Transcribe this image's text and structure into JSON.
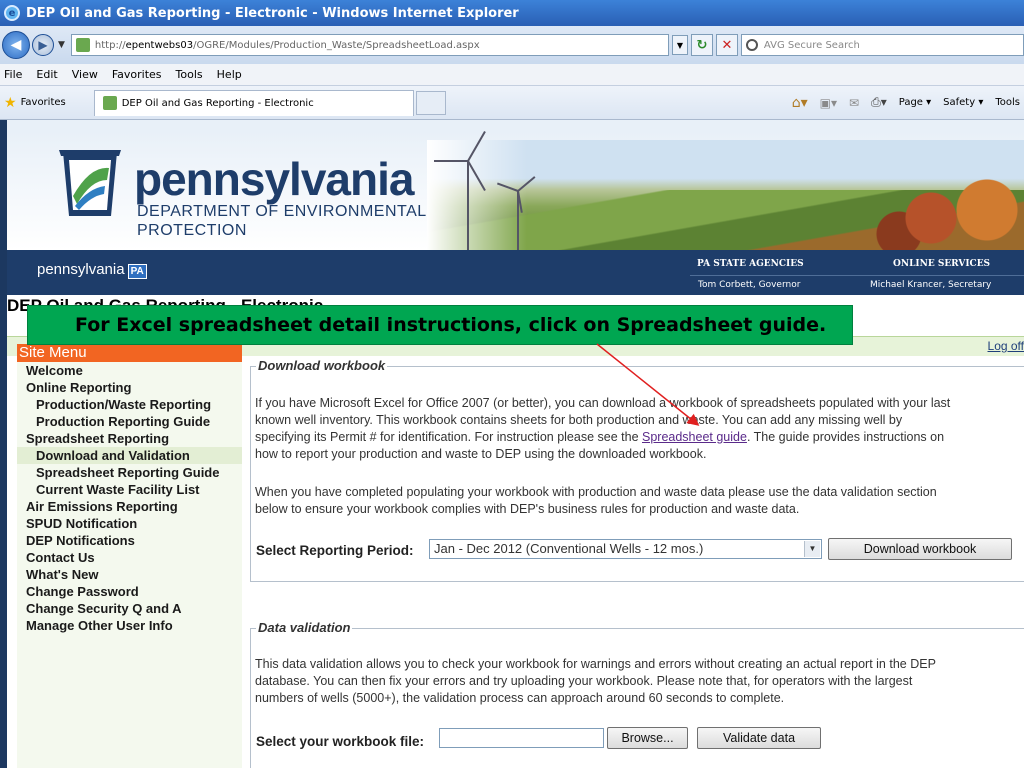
{
  "window": {
    "title": "DEP Oil and Gas Reporting - Electronic - Windows Internet Explorer"
  },
  "addressbar": {
    "url_prefix": "http://",
    "url_host": "epentwebs03",
    "url_path": "/OGRE/Modules/Production_Waste/SpreadsheetLoad.aspx",
    "search_placeholder": "AVG Secure Search"
  },
  "menubar": {
    "items": [
      "File",
      "Edit",
      "View",
      "Favorites",
      "Tools",
      "Help"
    ]
  },
  "favbar": {
    "favorites_label": "Favorites",
    "tab_title": "DEP Oil and Gas Reporting - Electronic",
    "commands": [
      "Page",
      "Safety",
      "Tools"
    ]
  },
  "banner": {
    "brand": "pennsylvania",
    "dept_line1": "DEPARTMENT OF ENVIRONMENTAL",
    "dept_line2": "PROTECTION"
  },
  "navstrip": {
    "pa_text": "pennsylvania",
    "pa_badge": "PA",
    "agencies": "PA STATE AGENCIES",
    "services": "ONLINE SERVICES",
    "governor": "Tom Corbett, Governor",
    "secretary": "Michael Krancer, Secretary"
  },
  "site_title": "DEP Oil and Gas Reporting - Electronic",
  "logoff": "Log off",
  "callout": "For Excel spreadsheet  detail instructions, click on Spreadsheet guide.",
  "sidemenu": {
    "heading": "Site Menu",
    "items": [
      {
        "label": "Welcome",
        "level": 1
      },
      {
        "label": "Online Reporting",
        "level": 1
      },
      {
        "label": "Production/Waste Reporting",
        "level": 2
      },
      {
        "label": "Production Reporting Guide",
        "level": 2
      },
      {
        "label": "Spreadsheet Reporting",
        "level": 1
      },
      {
        "label": "Download and Validation",
        "level": 2,
        "active": true
      },
      {
        "label": "Spreadsheet Reporting Guide",
        "level": 2
      },
      {
        "label": "Current Waste Facility List",
        "level": 2
      },
      {
        "label": "Air Emissions Reporting",
        "level": 1
      },
      {
        "label": "SPUD Notification",
        "level": 1
      },
      {
        "label": "DEP Notifications",
        "level": 1
      },
      {
        "label": "Contact Us",
        "level": 1
      },
      {
        "label": "What's New",
        "level": 1
      },
      {
        "label": "Change Password",
        "level": 1
      },
      {
        "label": "Change Security Q and A",
        "level": 1
      },
      {
        "label": "Manage Other User Info",
        "level": 1
      }
    ]
  },
  "download": {
    "legend": "Download workbook",
    "para1_a": "If you have Microsoft Excel for Office 2007 (or better), you can download a workbook of spreadsheets populated with your last",
    "para1_b": "known well inventory. This workbook contains sheets for both production and waste. You can add any missing well by",
    "para1_c_pre": "specifying its Permit # for identification. For instruction please see the ",
    "para1_c_link": "Spreadsheet guide",
    "para1_c_post": ". The guide provides instructions on",
    "para1_d": "how to report your production and waste to DEP using the downloaded workbook.",
    "para2_a": "When you have completed populating your workbook with production and waste data please use the data validation section",
    "para2_b": "below to ensure your workbook complies with DEP's business rules for production and waste data.",
    "period_label": "Select Reporting Period:",
    "period_value": "Jan - Dec 2012 (Conventional Wells - 12 mos.)",
    "download_button": "Download workbook"
  },
  "validation": {
    "legend": "Data validation",
    "para_a": "This data validation allows you to check your workbook for warnings and errors without creating an actual report in the DEP",
    "para_b": "database. You can then fix your errors and try uploading your workbook. Please note that, for operators with the largest",
    "para_c": "numbers of wells (5000+), the validation process can approach around 60 seconds to complete.",
    "file_label": "Select your workbook file:",
    "browse_button": "Browse...",
    "validate_button": "Validate data"
  },
  "colors": {
    "ie_title": "#2a5fb4",
    "navy": "#1e3d6a",
    "menu_orange": "#f26522",
    "callout_green": "#00a651",
    "arrow_red": "#e02020"
  }
}
